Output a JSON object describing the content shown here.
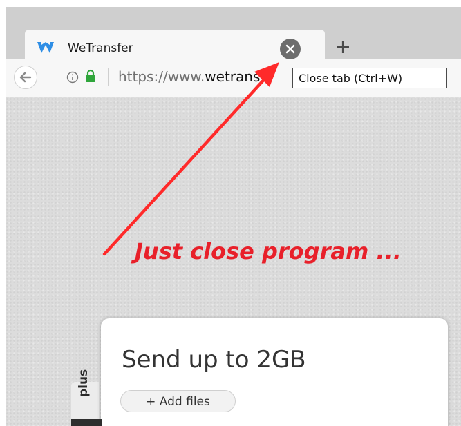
{
  "browser": {
    "tab": {
      "title": "WeTransfer"
    },
    "new_tab_label": "+",
    "url": {
      "prefix": "https://www.",
      "domain": "wetrans"
    },
    "tooltip": "Close tab (Ctrl+W)"
  },
  "annotation": {
    "text": "Just close program ...",
    "color": "#e8202a"
  },
  "page": {
    "side_tab": "plus",
    "card": {
      "title": "Send up to 2GB",
      "add_files": "+ Add files"
    }
  }
}
